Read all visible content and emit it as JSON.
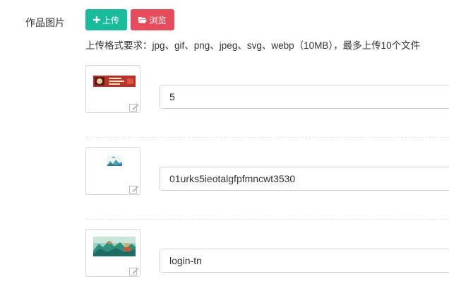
{
  "form": {
    "label": "作品图片",
    "upload_label": "上传",
    "browse_label": "浏览",
    "hint": "上传格式要求：jpg、gif、png、jpeg、svg、webp（10MB），最多上传10个文件"
  },
  "images": [
    {
      "name": "5",
      "icon": "banner-thumbnail"
    },
    {
      "name": "01urks5ieotalgfpfmncwt3530",
      "icon": "small-landscape-thumbnail"
    },
    {
      "name": "login-tn",
      "icon": "landscape-painting-thumbnail"
    }
  ],
  "colors": {
    "upload_button": "#18bc9c",
    "browse_button": "#e74c5c"
  }
}
